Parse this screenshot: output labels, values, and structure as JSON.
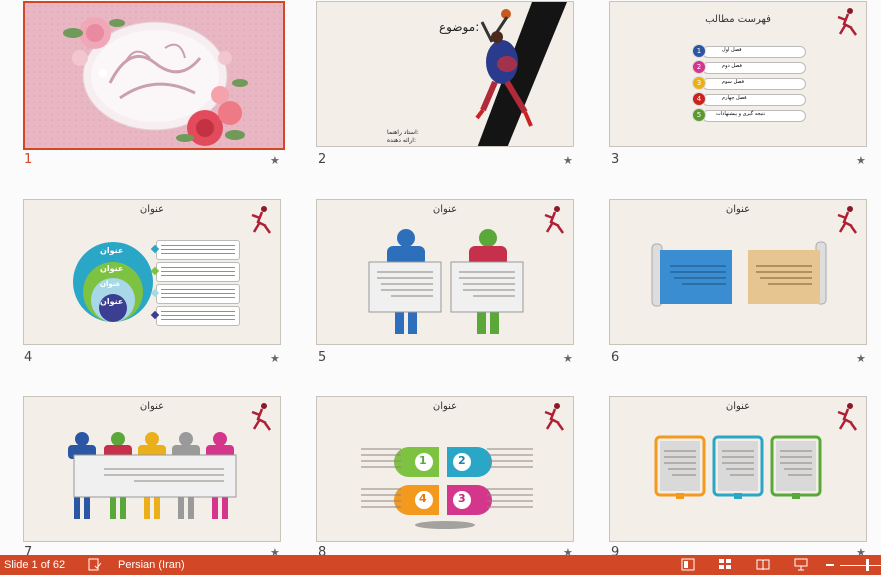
{
  "slides": [
    {
      "num": "1"
    },
    {
      "num": "2",
      "subject": "موضوع:",
      "advisor": "استاد راهنما:",
      "presenter": "ارائه دهنده:"
    },
    {
      "num": "3",
      "title": "فهرست مطالب",
      "toc": [
        {
          "n": "1",
          "label": "فصل اول",
          "color": "#2b56a4"
        },
        {
          "n": "2",
          "label": "فصل دوم",
          "color": "#d3368b"
        },
        {
          "n": "3",
          "label": "فصل سوم",
          "color": "#e9b01c"
        },
        {
          "n": "4",
          "label": "فصل چهارم",
          "color": "#c9241f"
        },
        {
          "n": "5",
          "label": "نتیجه گیری و پیشنهادات",
          "color": "#5b9a2d"
        }
      ]
    },
    {
      "num": "4",
      "title": "عنوان",
      "circle_label": "عنوان"
    },
    {
      "num": "5",
      "title": "عنوان"
    },
    {
      "num": "6",
      "title": "عنوان"
    },
    {
      "num": "7",
      "title": "عنوان"
    },
    {
      "num": "8",
      "title": "عنوان",
      "petals": [
        "1",
        "2",
        "4",
        "3"
      ]
    },
    {
      "num": "9",
      "title": "عنوان"
    }
  ],
  "star_glyph": "★",
  "statusbar": {
    "slide_info": "Slide 1 of 62",
    "language": "Persian (Iran)"
  }
}
